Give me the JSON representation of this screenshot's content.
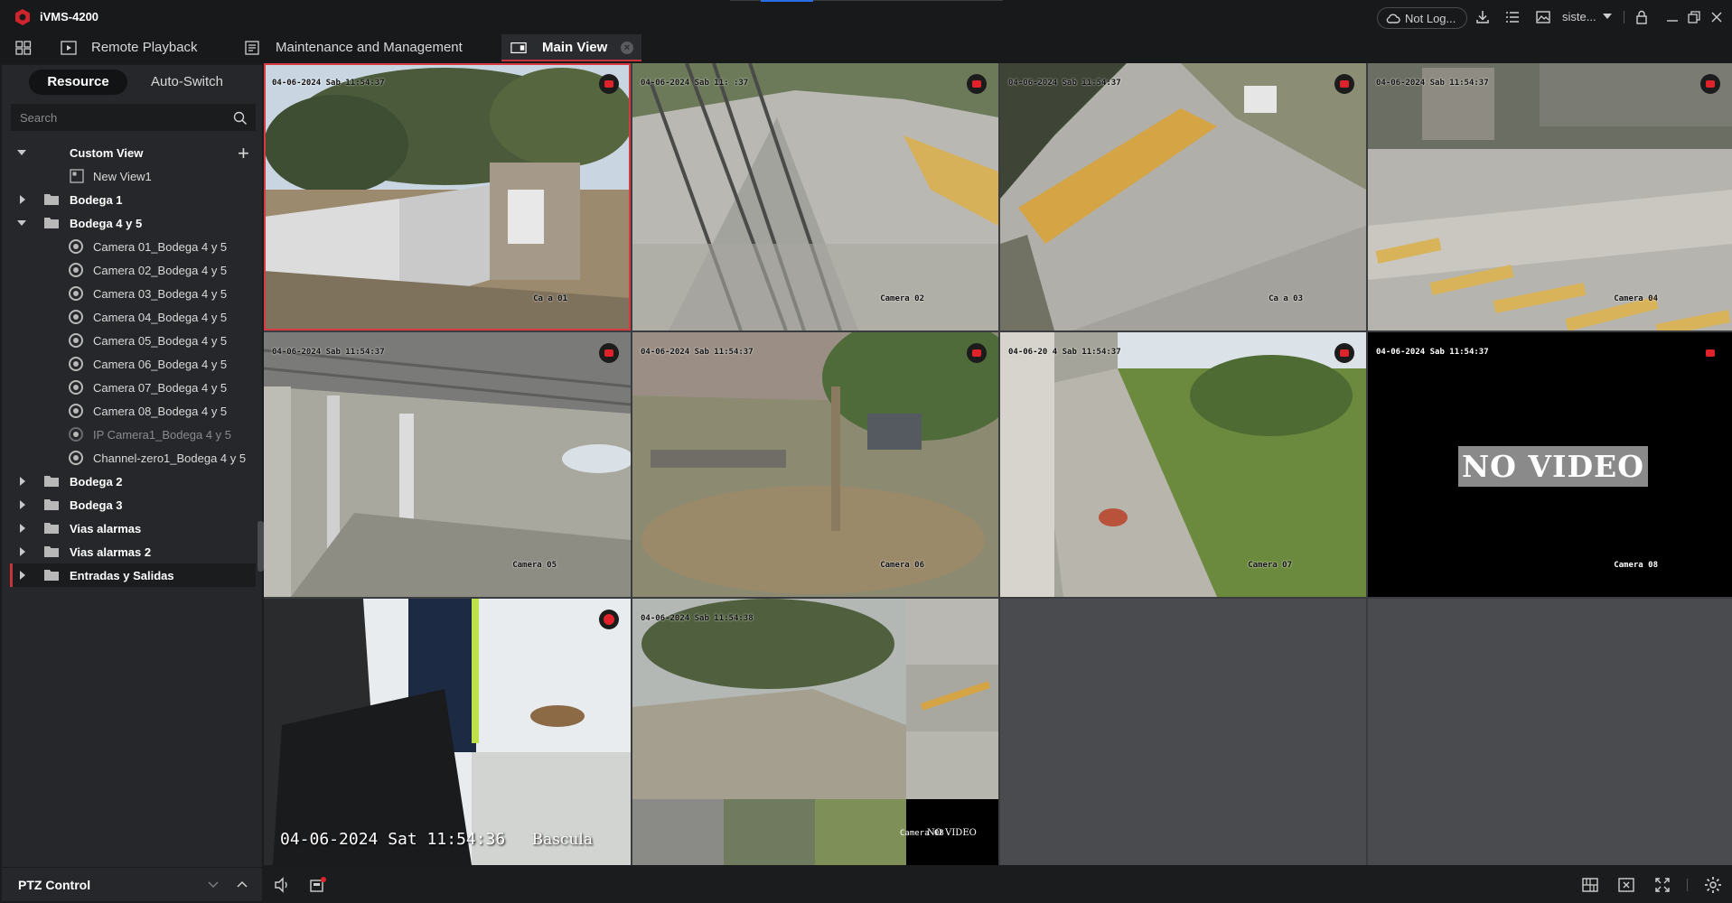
{
  "app": {
    "title": "iVMS-4200",
    "account_label": "Not Log...",
    "user_label": "siste...",
    "icons": [
      "hikvision-logo",
      "cloud-icon",
      "download-icon",
      "list-icon",
      "image-icon",
      "lock-icon",
      "minimize-icon",
      "restore-icon",
      "close-icon"
    ],
    "accent_color": "#c8323a"
  },
  "tabs": [
    {
      "label": "Remote Playback",
      "active": false,
      "icon": "playback-icon"
    },
    {
      "label": "Maintenance and Management",
      "active": false,
      "icon": "maintenance-icon"
    },
    {
      "label": "Main View",
      "active": true,
      "icon": "main-view-icon"
    }
  ],
  "sidebar": {
    "segments": {
      "resource": "Resource",
      "auto_switch": "Auto-Switch"
    },
    "search_placeholder": "Search",
    "tree": [
      {
        "label": "Custom View",
        "type": "group",
        "expanded": true
      },
      {
        "label": "New View1",
        "type": "view"
      },
      {
        "label": "Bodega 1",
        "type": "folder",
        "expanded": false
      },
      {
        "label": "Bodega 4 y 5",
        "type": "folder",
        "expanded": true
      },
      {
        "label": "Camera 01_Bodega 4 y 5",
        "type": "camera"
      },
      {
        "label": "Camera 02_Bodega 4 y 5",
        "type": "camera"
      },
      {
        "label": "Camera 03_Bodega 4 y 5",
        "type": "camera"
      },
      {
        "label": "Camera 04_Bodega 4 y 5",
        "type": "camera"
      },
      {
        "label": "Camera 05_Bodega 4 y 5",
        "type": "camera"
      },
      {
        "label": "Camera 06_Bodega 4 y 5",
        "type": "camera"
      },
      {
        "label": "Camera 07_Bodega 4 y 5",
        "type": "camera"
      },
      {
        "label": "Camera 08_Bodega 4 y 5",
        "type": "camera"
      },
      {
        "label": "IP Camera1_Bodega 4 y 5",
        "type": "camera",
        "offline": true
      },
      {
        "label": "Channel-zero1_Bodega 4 y 5",
        "type": "camera"
      },
      {
        "label": "Bodega 2",
        "type": "folder",
        "expanded": false
      },
      {
        "label": "Bodega 3",
        "type": "folder",
        "expanded": false
      },
      {
        "label": "Vias alarmas",
        "type": "folder",
        "expanded": false
      },
      {
        "label": "Vias alarmas 2",
        "type": "folder",
        "expanded": false
      },
      {
        "label": "Entradas y Salidas",
        "type": "folder",
        "expanded": false,
        "selected": true
      }
    ],
    "ptz_label": "PTZ Control"
  },
  "grid": {
    "tiles": [
      {
        "date": "04-06-2024 Sab 11:54:37",
        "camera": "Ca    a 01",
        "recording": true,
        "selected": true
      },
      {
        "date": "04-06-2024 Sab 11:  :37",
        "camera": "Camera 02",
        "recording": true
      },
      {
        "date": "04-06-2024 Sab 11:54:37",
        "camera": "Ca    a 03",
        "recording": true
      },
      {
        "date": "04-06-2024 Sab 11:54:37",
        "camera": "Camera 04",
        "recording": true
      },
      {
        "date": "04-06-2024 Sab 11:54:37",
        "camera": "Camera 05",
        "recording": true
      },
      {
        "date": "04-06-2024 Sab 11:54:37",
        "camera": "Camera 06",
        "recording": true
      },
      {
        "date": "04-06-20  4 Sab 11:54:37",
        "camera": "Camera 07",
        "recording": true
      },
      {
        "date": "04-06-2024 Sab 11:54:37",
        "camera": "Camera 08",
        "recording": true,
        "no_video": "NO VIDEO"
      },
      {
        "date": "04-06-2024 Sat 11:54:36",
        "camera": "Bascula",
        "recording": true
      },
      {
        "date": "04-06-2024 Sab 11:54:38",
        "camera": "Camera 08",
        "recording": false,
        "no_video": "NO VIDEO"
      }
    ]
  },
  "bottombar_icons": [
    "volume-icon",
    "record-all-icon",
    "layout-icon",
    "close-all-icon",
    "fullscreen-icon",
    "settings-icon"
  ]
}
